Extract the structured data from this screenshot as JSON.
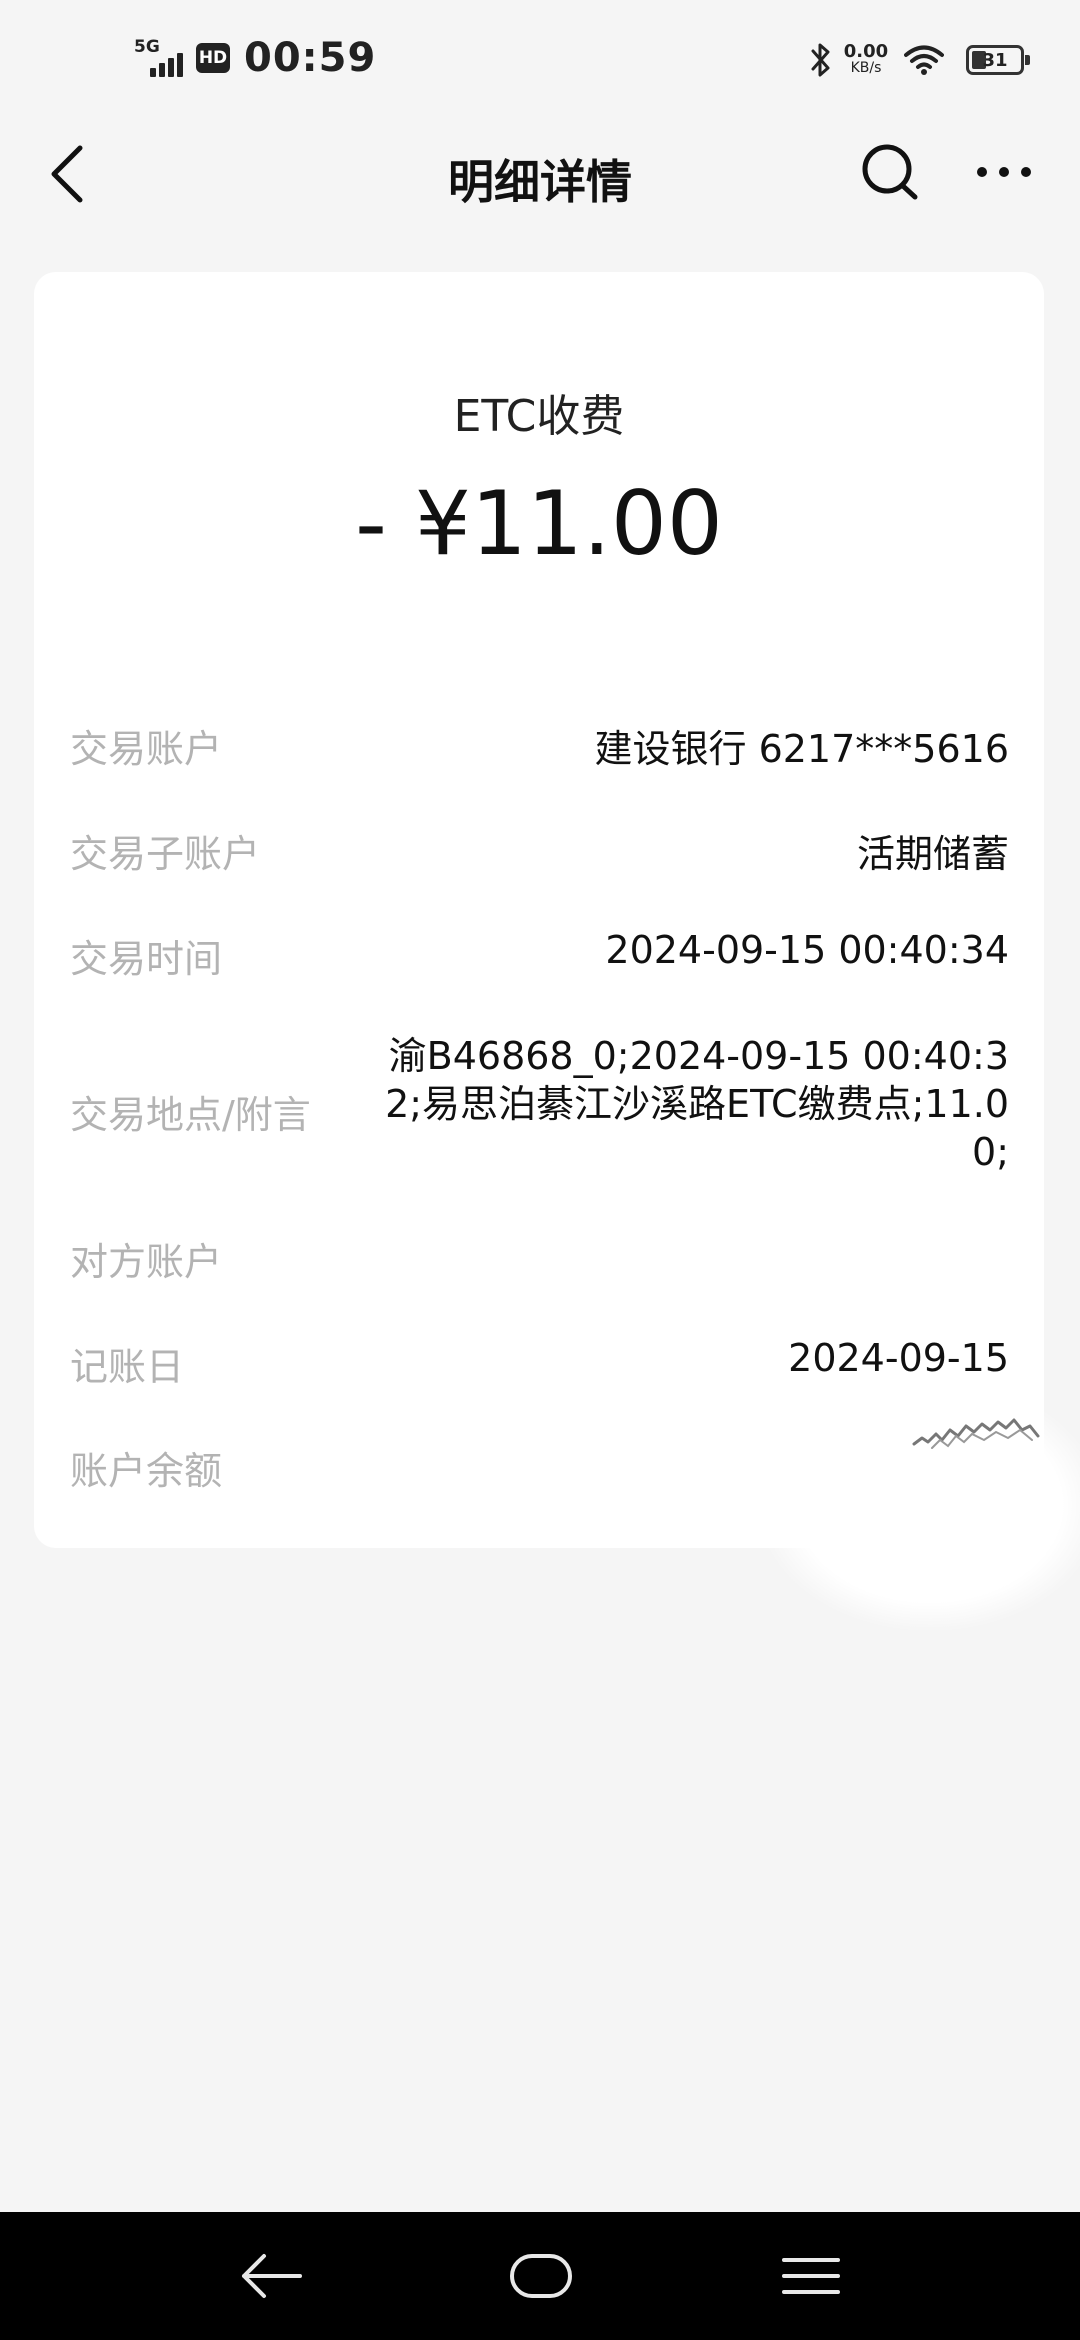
{
  "status_bar": {
    "network": "5G",
    "hd_badge": "HD",
    "time": "00:59",
    "net_speed_value": "0.00",
    "net_speed_unit": "KB/s",
    "battery_level": "31",
    "icons": [
      "signal-icon",
      "hd-icon",
      "bluetooth-icon",
      "wifi-icon",
      "battery-icon"
    ]
  },
  "header": {
    "title": "明细详情",
    "back_icon": "chevron-left-icon",
    "search_icon": "search-icon",
    "more_icon": "more-horizontal-icon"
  },
  "transaction": {
    "type": "ETC收费",
    "amount": "- ¥11.00",
    "fields": [
      {
        "label": "交易账户",
        "value": "建设银行 6217***5616"
      },
      {
        "label": "交易子账户",
        "value": "活期储蓄"
      },
      {
        "label": "交易时间",
        "value": "2024-09-15 00:40:34"
      },
      {
        "label": "交易地点/附言",
        "value": "渝B46868_0;2024-09-15 00:40:32;易思泊綦江沙溪路ETC缴费点;11.00;"
      },
      {
        "label": "对方账户",
        "value": ""
      },
      {
        "label": "记账日",
        "value": "2024-09-15"
      },
      {
        "label": "账户余额",
        "value": ""
      }
    ]
  },
  "system_nav": {
    "icons": [
      "back-arrow-icon",
      "home-icon",
      "menu-icon"
    ]
  }
}
